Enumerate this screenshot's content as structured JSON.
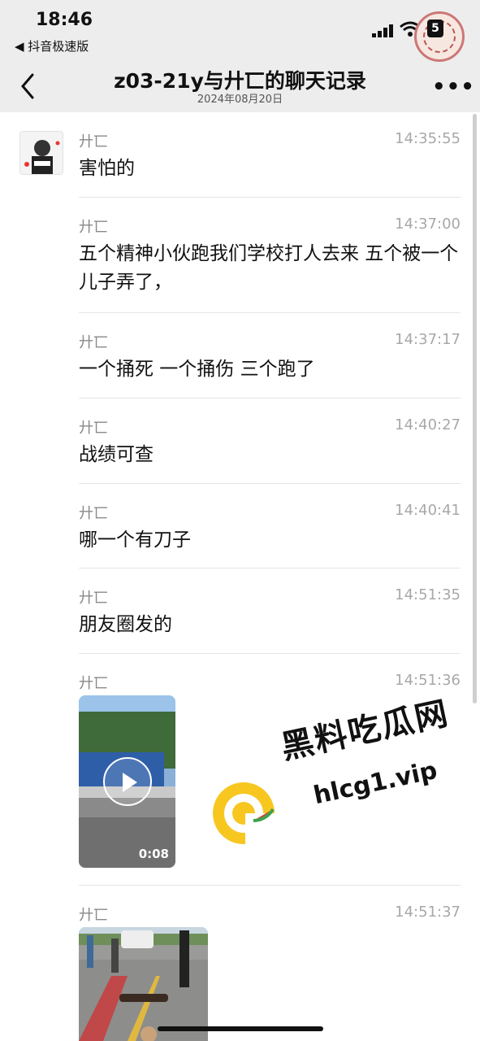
{
  "status": {
    "time": "18:46",
    "back_app": "◀ 抖音极速版",
    "battery": "5"
  },
  "nav": {
    "title": "z03-21y与廾匸的聊天记录",
    "subtitle": "2024年08月20日",
    "back_icon": "chevron-left-icon",
    "more_label": "•••"
  },
  "messages": [
    {
      "sender": "廾匸",
      "time": "14:35:55",
      "text": "害怕的"
    },
    {
      "sender": "廾匸",
      "time": "14:37:00",
      "text": "五个精神小伙跑我们学校打人去来  五个被一个儿子弄了，"
    },
    {
      "sender": "廾匸",
      "time": "14:37:17",
      "text": "一个捅死 一个捅伤    三个跑了"
    },
    {
      "sender": "廾匸",
      "time": "14:40:27",
      "text": "战绩可查"
    },
    {
      "sender": "廾匸",
      "time": "14:40:41",
      "text": "哪一个有刀子"
    },
    {
      "sender": "廾匸",
      "time": "14:51:35",
      "text": "朋友圈发的"
    },
    {
      "sender": "廾匸",
      "time": "14:51:36",
      "video_duration": "0:08"
    },
    {
      "sender": "廾匸",
      "time": "14:51:37"
    }
  ],
  "watermark": {
    "text": "黑料吃瓜网",
    "url": "hlcg1.vip"
  },
  "colors": {
    "top_bg": "#ededed",
    "sender": "#8a8a8a",
    "time": "#a8a8a8",
    "divider": "#e6e6e6"
  }
}
